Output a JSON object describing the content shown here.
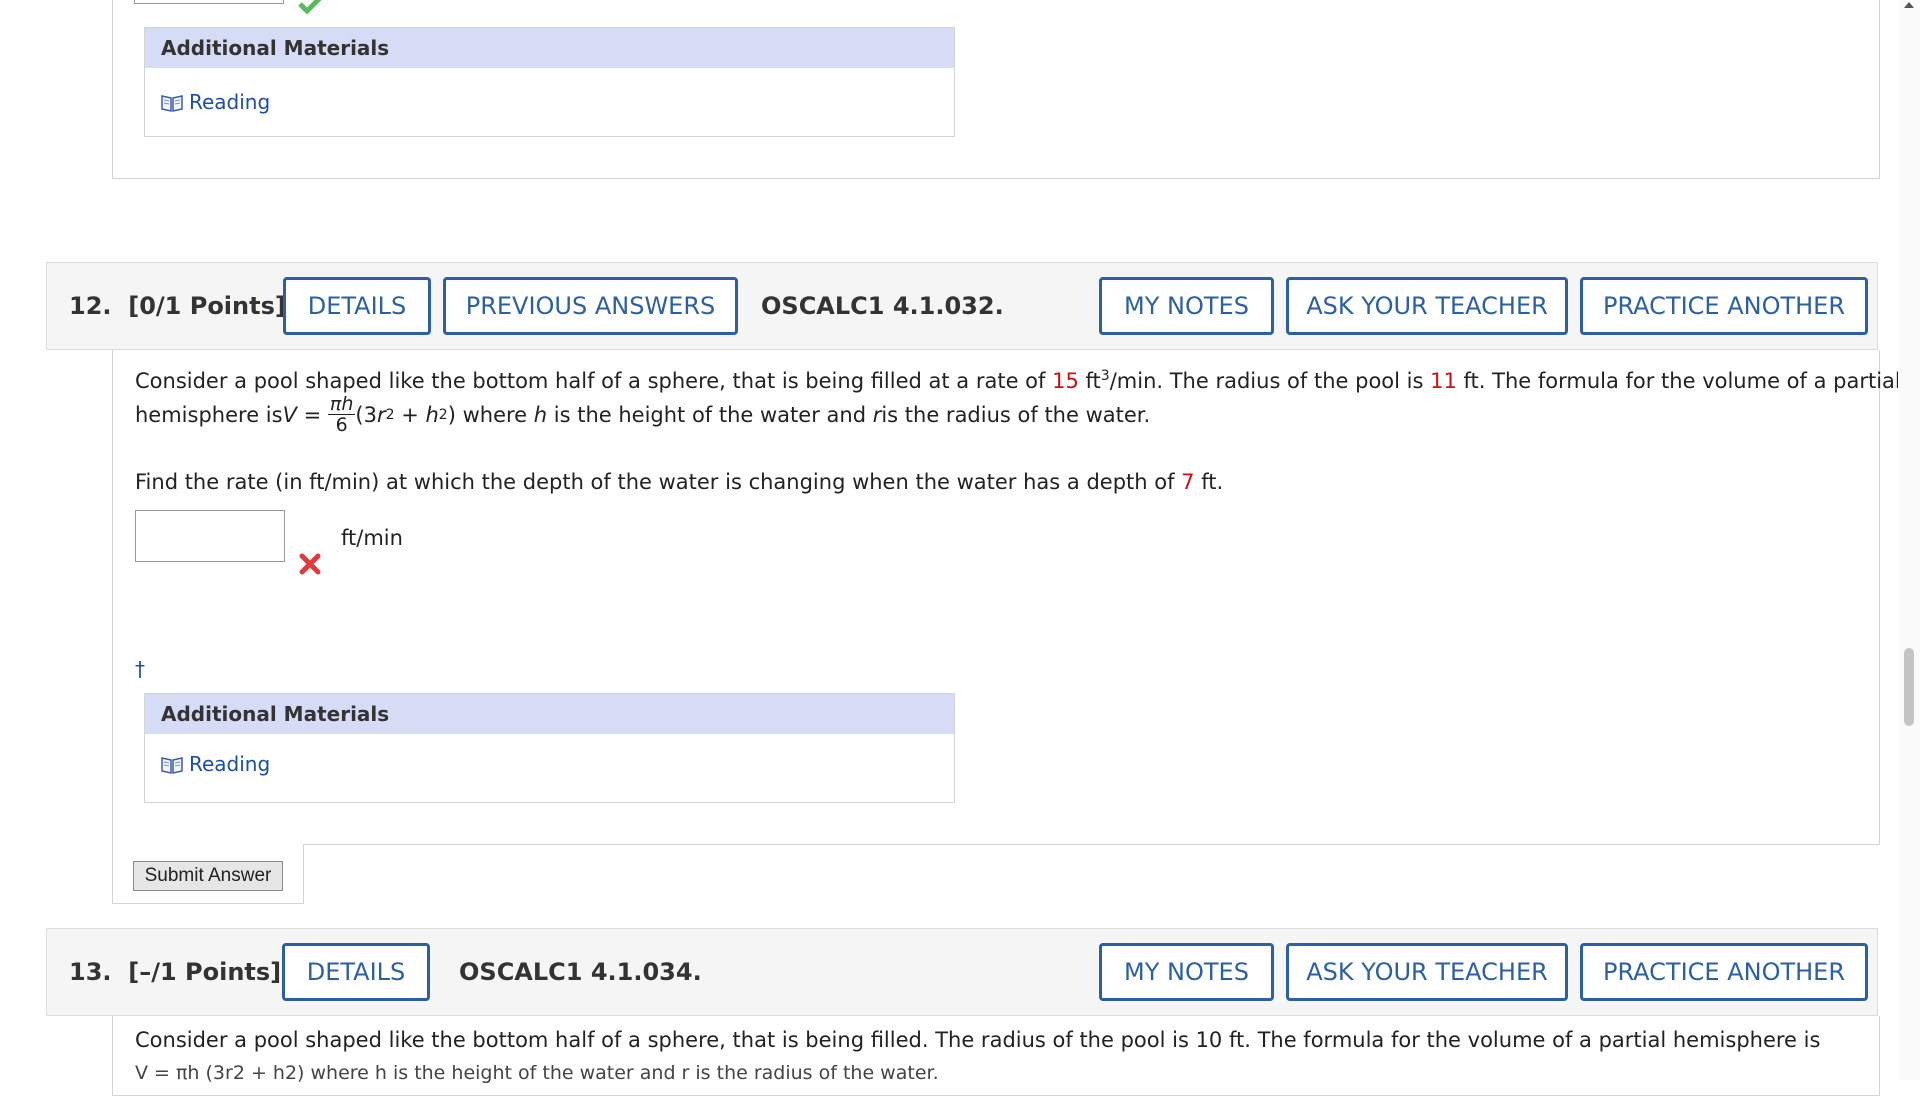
{
  "previous": {
    "additional_materials_title": "Additional Materials",
    "reading_label": "Reading"
  },
  "q12": {
    "number": "12.",
    "points": "[0/1 Points]",
    "details_label": "DETAILS",
    "previous_answers_label": "PREVIOUS ANSWERS",
    "reference": "OSCALC1 4.1.032.",
    "my_notes_label": "MY NOTES",
    "ask_teacher_label": "ASK YOUR TEACHER",
    "practice_label": "PRACTICE ANOTHER",
    "text1_a": "Consider a pool shaped like the bottom half of a sphere, that is being filled at a rate of ",
    "rate": "15",
    "text1_b": " ft",
    "text1_b_sup": "3",
    "text1_c": "/min. The radius of the pool is ",
    "radius": "11",
    "text1_d": " ft. The formula for the volume of a partial",
    "text2_a": "hemisphere is ",
    "formula_v": "V",
    "formula_eq": " = ",
    "formula_num": "πh",
    "formula_den": "6",
    "formula_rest_a": "(3",
    "formula_r": "r",
    "formula_sup1": "2",
    "formula_plus": " + ",
    "formula_h": "h",
    "formula_sup2": "2",
    "formula_close": ")",
    "text2_b": " where ",
    "text2_h": "h",
    "text2_c": " is the height of the water and ",
    "text2_r": "r",
    "text2_d": " is the radius of the water.",
    "find_a": "Find the rate (in ft/min) at which the depth of the water is changing when the water has a depth of ",
    "depth": "7",
    "find_b": " ft.",
    "answer_value": "",
    "unit": "ft/min",
    "dagger": "†",
    "additional_materials_title": "Additional Materials",
    "reading_label": "Reading",
    "submit_label": "Submit Answer"
  },
  "q13": {
    "number": "13.",
    "points": "[–/1 Points]",
    "details_label": "DETAILS",
    "reference": "OSCALC1 4.1.034.",
    "my_notes_label": "MY NOTES",
    "ask_teacher_label": "ASK YOUR TEACHER",
    "practice_label": "PRACTICE ANOTHER",
    "text1": "Consider a pool shaped like the bottom half of a sphere, that is being filled. The radius of the pool is 10 ft. The formula for the volume of a partial hemisphere is",
    "text2": "V = πh (3r2 + h2) where h is the height of the water and r is the radius of the water."
  },
  "colors": {
    "accent": "#2d5fa3",
    "highlight_red": "#cc1111",
    "materials_header": "#d6dcf6",
    "correct_green": "#5cb85c",
    "incorrect_red": "#e03a3a"
  }
}
